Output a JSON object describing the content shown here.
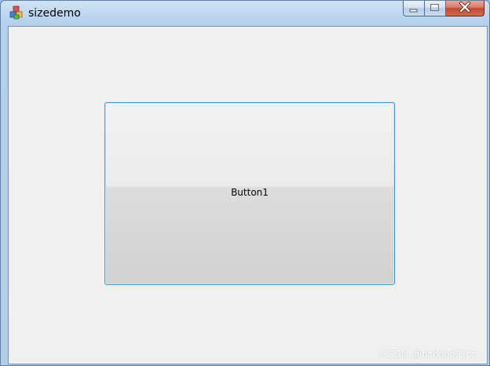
{
  "window": {
    "title": "sizedemo",
    "icon": "app-blocks-icon"
  },
  "caption_buttons": {
    "minimize_icon": "minimize-icon",
    "maximize_icon": "maximize-icon",
    "close_icon": "close-icon"
  },
  "main": {
    "button_label": "Button1"
  },
  "watermark": "CSDN @bcbobo21cn",
  "colors": {
    "button_border": "#3c9ad4",
    "client_background": "#f0f0f0",
    "close_button": "#c24a30"
  }
}
